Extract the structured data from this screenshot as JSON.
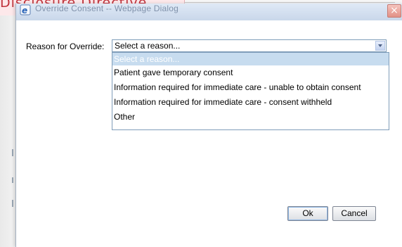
{
  "background": {
    "banner_text": "Disclosure Directive"
  },
  "dialog": {
    "title": "Override Consent -- Webpage Dialog",
    "close_glyph": "×",
    "reason_label": "Reason for Override:",
    "select": {
      "selected_value": "Select a reason...",
      "options": [
        "Select a reason...",
        "Patient gave temporary consent",
        "Information required for immediate care - unable to obtain consent",
        "Information required for immediate care - consent withheld",
        "Other"
      ]
    },
    "buttons": {
      "ok": "Ok",
      "cancel": "Cancel"
    }
  },
  "colors": {
    "highlight": "#c7dcef",
    "close_button": "#e29186",
    "title_bar": "#c9d7ea"
  },
  "icons": {
    "title_icon": "ie-page-icon",
    "close_icon": "close-icon",
    "dropdown_icon": "chevron-down-icon"
  }
}
